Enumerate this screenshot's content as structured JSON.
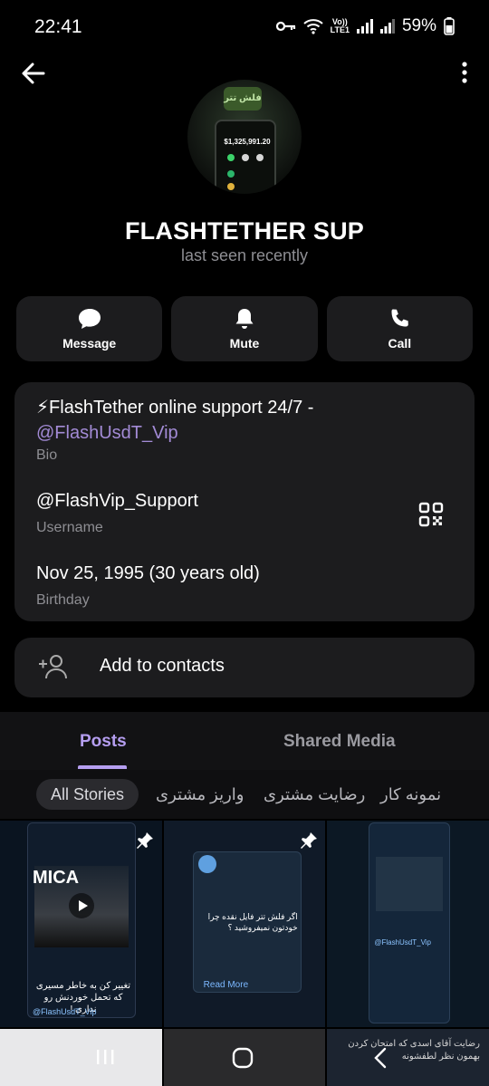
{
  "status_bar": {
    "time": "22:41",
    "battery": "59%",
    "network": "LTE1",
    "volte": "Vo))"
  },
  "profile": {
    "name": "FLASHTETHER SUP",
    "status": "last seen recently",
    "avatar_amount": "$1,325,991.20"
  },
  "actions": [
    {
      "label": "Message",
      "icon": "chat-bubble-icon"
    },
    {
      "label": "Mute",
      "icon": "bell-icon"
    },
    {
      "label": "Call",
      "icon": "phone-icon"
    }
  ],
  "info": {
    "bio_text": "⚡FlashTether online support 24/7 -",
    "bio_link": "@FlashUsdT_Vip",
    "bio_label": "Bio",
    "username": "@FlashVip_Support",
    "username_label": "Username",
    "birthday": "Nov 25, 1995 (30 years old)",
    "birthday_label": "Birthday"
  },
  "add_contact": {
    "label": "Add to contacts"
  },
  "tabs": [
    {
      "label": "Posts",
      "active": true
    },
    {
      "label": "Shared Media",
      "active": false
    }
  ],
  "story_filters": [
    {
      "label": "All Stories",
      "active": true
    },
    {
      "label": "واریز مشتری",
      "active": false
    },
    {
      "label": "رضایت مشتری",
      "active": false
    },
    {
      "label": "نمونه کار",
      "active": false
    }
  ],
  "posts": [
    {
      "caption_top": "MICA",
      "caption": "تغییر کن به خاطر مسیری که تحمل خوردنش رو نداری !",
      "channel": "@FlashUsdT_Vip"
    },
    {
      "read_more": "Read More",
      "question": "اگر فلش تتر فایل نقده چرا خودتون نمیفروشید ؟"
    },
    {
      "channel": "@FlashUsdT_Vip"
    }
  ],
  "bottom_caption": "رضایت آقای اسدی که امتحان کردن بهمون نظر لطفشونه",
  "colors": {
    "accent": "#b59ef0",
    "link": "#a38bd6",
    "card": "#1c1c1e"
  }
}
